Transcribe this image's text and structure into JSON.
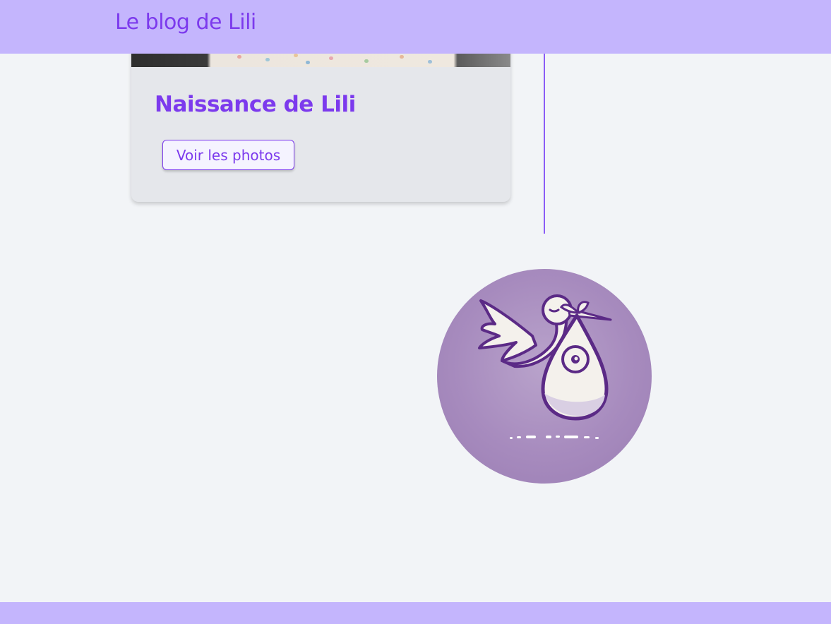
{
  "header": {
    "site_title": "Le blog de Lili"
  },
  "post": {
    "title": "Naissance de Lili",
    "button_label": "Voir les photos"
  },
  "icons": {
    "emblem": "stork-baby-icon"
  },
  "colors": {
    "header_bg": "#c4b5fd",
    "accent": "#7c3aed",
    "page_bg": "#f2f4f7",
    "card_bg": "#e5e7eb",
    "emblem_bg": "#a78bbe"
  }
}
